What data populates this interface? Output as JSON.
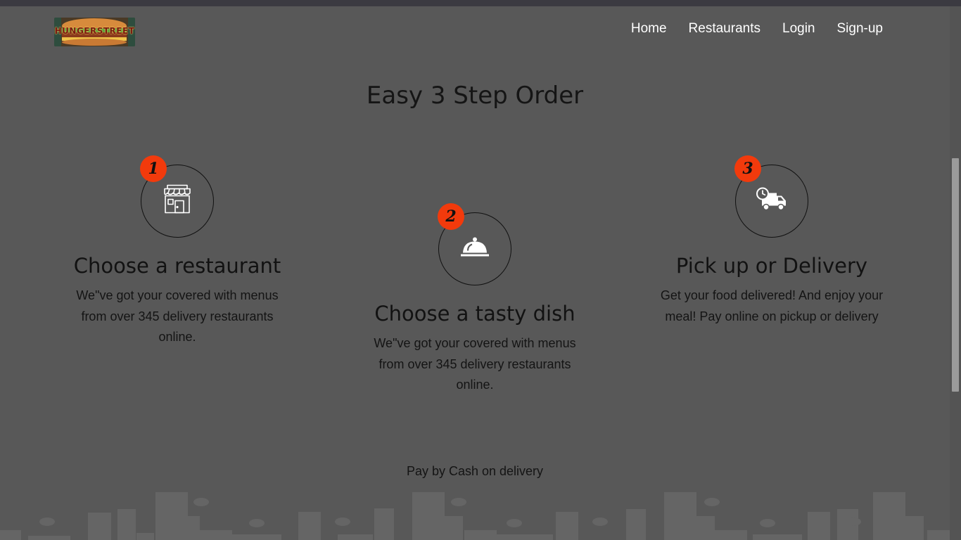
{
  "header": {
    "logo_text": "HUNGERSTREET",
    "nav": [
      "Home",
      "Restaurants",
      "Login",
      "Sign-up"
    ]
  },
  "main": {
    "title": "Easy 3 Step Order",
    "steps": [
      {
        "number": "1",
        "icon": "storefront-icon",
        "title": "Choose a restaurant",
        "description": "We\"ve got your covered with menus from over 345 delivery restaurants online."
      },
      {
        "number": "2",
        "icon": "food-cloche-icon",
        "title": "Choose a tasty dish",
        "description": "We\"ve got your covered with menus from over 345 delivery restaurants online."
      },
      {
        "number": "3",
        "icon": "delivery-truck-clock-icon",
        "title": "Pick up or Delivery",
        "description": "Get your food delivered! And enjoy your meal! Pay online on pickup or delivery"
      }
    ],
    "pay_note": "Pay by Cash on delivery"
  },
  "colors": {
    "background": "#585858",
    "badge": "#f23a0c",
    "nav_text": "#ffffff",
    "text": "#141414"
  }
}
